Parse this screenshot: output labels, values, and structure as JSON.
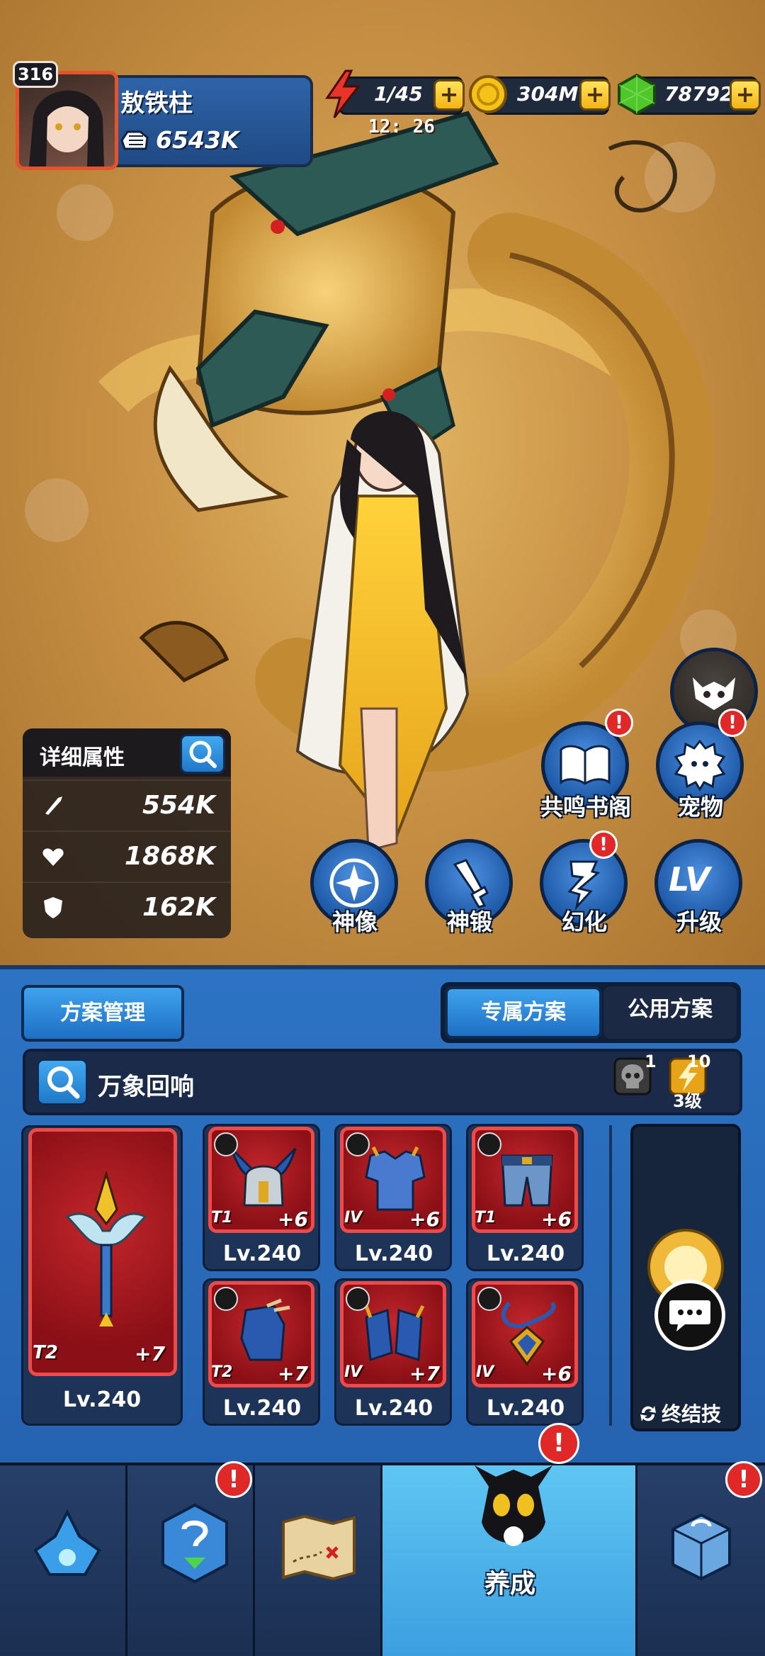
{
  "player": {
    "level": "316",
    "name": "敖铁柱",
    "power": "6543K"
  },
  "resources": {
    "energy": "1/45",
    "energy_timer": "12: 26",
    "gold": "304M",
    "gems": "78792"
  },
  "stats_panel": {
    "title": "详细属性",
    "attack": "554K",
    "health": "1868K",
    "defense": "162K"
  },
  "actions": {
    "resonance_library": "共鸣书阁",
    "pet": "宠物",
    "statue": "神像",
    "forge": "神锻",
    "transform": "幻化",
    "upgrade": "升级",
    "upgrade_icon_text": "LV"
  },
  "plan": {
    "manage_label": "方案管理",
    "tab_exclusive": "专属方案",
    "tab_public": "公用方案",
    "set_name": "万象回响",
    "skull_count": "1",
    "charge_count": "10",
    "charge_level": "3级"
  },
  "equipment": {
    "weapon": {
      "tier": "T2",
      "plus": "+7",
      "level": "Lv.240"
    },
    "slots": [
      {
        "tier": "T1",
        "plus": "+6",
        "level": "Lv.240"
      },
      {
        "tier": "IV",
        "plus": "+6",
        "level": "Lv.240"
      },
      {
        "tier": "T1",
        "plus": "+6",
        "level": "Lv.240"
      },
      {
        "tier": "T2",
        "plus": "+7",
        "level": "Lv.240"
      },
      {
        "tier": "IV",
        "plus": "+7",
        "level": "Lv.240"
      },
      {
        "tier": "IV",
        "plus": "+6",
        "level": "Lv.240"
      }
    ],
    "ultimate_label": "终结技"
  },
  "nav": {
    "active_label": "养成"
  },
  "colors": {
    "accent_blue": "#2d73c4",
    "alert_red": "#e02828",
    "slot_red": "#c2262b",
    "gold": "#f3b416",
    "gem_green": "#4fc72a"
  }
}
